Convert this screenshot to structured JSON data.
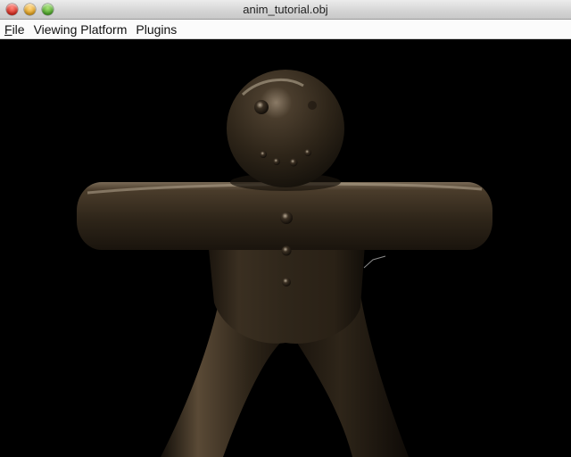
{
  "window": {
    "title": "anim_tutorial.obj",
    "buttons": {
      "close": "close-window-button",
      "minimize": "minimize-window-button",
      "zoom": "zoom-window-button"
    }
  },
  "menubar": {
    "items": [
      {
        "mnemonic": "F",
        "rest": "ile"
      },
      {
        "mnemonic": "",
        "rest": "Viewing Platform"
      },
      {
        "mnemonic": "",
        "rest": "Plugins"
      }
    ]
  },
  "viewport": {
    "background": "#000000",
    "model_color": "#3d3224"
  }
}
